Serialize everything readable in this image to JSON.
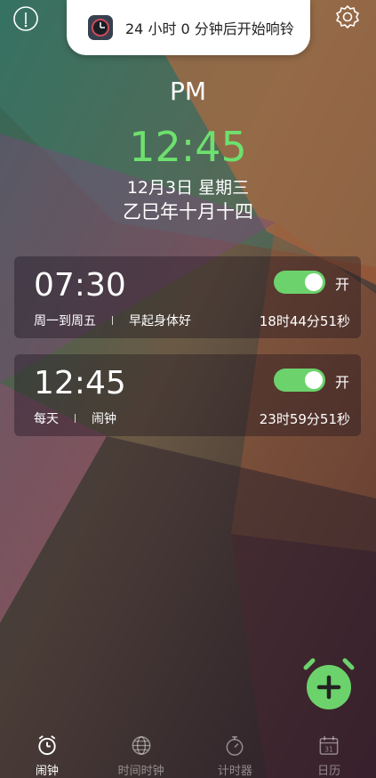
{
  "toast": {
    "message": "24 小时 0 分钟后开始响铃"
  },
  "clock": {
    "ampm": "PM",
    "time": "12:45",
    "date": "12月3日  星期三",
    "lunar": "乙巳年十月十四"
  },
  "alarms": [
    {
      "time": "07:30",
      "repeat": "周一到周五",
      "label": "早起身体好",
      "enabled": true,
      "state_label": "开",
      "remaining": "18时44分51秒"
    },
    {
      "time": "12:45",
      "repeat": "每天",
      "label": "闹钟",
      "enabled": true,
      "state_label": "开",
      "remaining": "23时59分51秒"
    }
  ],
  "nav": {
    "items": [
      {
        "label": "闹钟",
        "icon": "alarm-clock-icon",
        "active": true
      },
      {
        "label": "时间时钟",
        "icon": "globe-icon",
        "active": false
      },
      {
        "label": "计时器",
        "icon": "stopwatch-icon",
        "active": false
      },
      {
        "label": "日历",
        "icon": "calendar-icon",
        "active": false,
        "icon_text": "31"
      }
    ]
  },
  "colors": {
    "accent_green": "#6ee06e",
    "toggle_on": "#6cd26c",
    "fab": "#6cd26c"
  }
}
